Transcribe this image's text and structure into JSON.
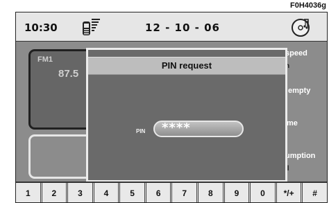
{
  "figure_code": "F0H4036g",
  "status_bar": {
    "time": "10:30",
    "date": "12 - 10 - 06",
    "phone_icon": "mobile-phone-signal-icon",
    "disc_icon": "cd-disc-icon"
  },
  "radio_panel": {
    "band": "FM1",
    "frequency": "87.5"
  },
  "right_labels": [
    "speed",
    "n",
    "empty",
    "me",
    "umption",
    "/l"
  ],
  "dialog": {
    "title": "PIN request",
    "pin_label": "PIN",
    "pin_value": "****"
  },
  "keypad": {
    "keys": [
      "1",
      "2",
      "3",
      "4",
      "5",
      "6",
      "7",
      "8",
      "9",
      "0",
      "*/+",
      "#"
    ]
  },
  "colors": {
    "screen_bg": "#8a8a8a",
    "dialog_bg": "#6a6a6a",
    "dialog_title_bg": "#bdbdbd",
    "status_bar_bg": "#e6e6e6"
  }
}
